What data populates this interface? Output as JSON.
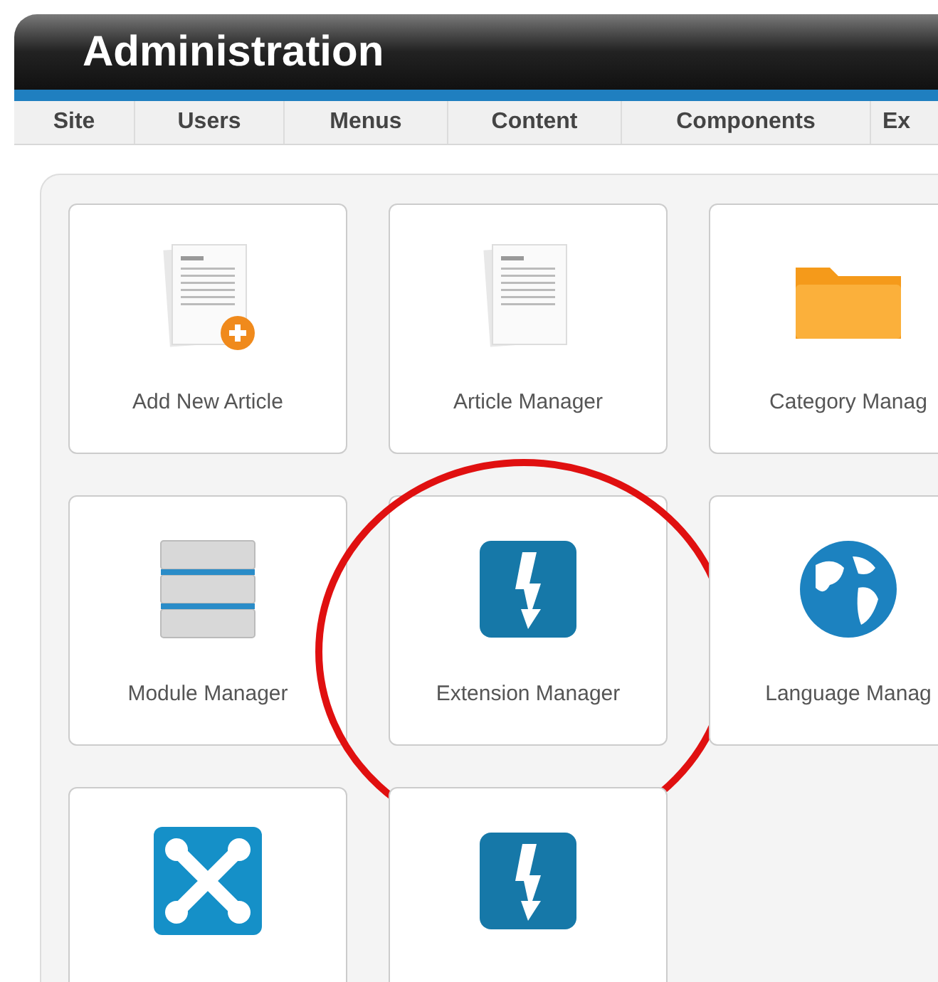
{
  "header": {
    "title": "Administration"
  },
  "tabs": [
    {
      "label": "Site"
    },
    {
      "label": "Users"
    },
    {
      "label": "Menus"
    },
    {
      "label": "Content"
    },
    {
      "label": "Components"
    },
    {
      "label": "Ex"
    }
  ],
  "tiles": [
    {
      "kind": "add-article",
      "label": "Add New Article",
      "highlighted": false
    },
    {
      "kind": "article",
      "label": "Article Manager",
      "highlighted": false
    },
    {
      "kind": "folder",
      "label": "Category Manag",
      "highlighted": false
    },
    {
      "kind": "stack",
      "label": "Module Manager",
      "highlighted": false
    },
    {
      "kind": "bolt",
      "label": "Extension Manager",
      "highlighted": true
    },
    {
      "kind": "globe",
      "label": "Language Manag",
      "highlighted": false
    },
    {
      "kind": "joomla",
      "highlighted": false
    },
    {
      "kind": "bolt",
      "highlighted": false
    }
  ]
}
